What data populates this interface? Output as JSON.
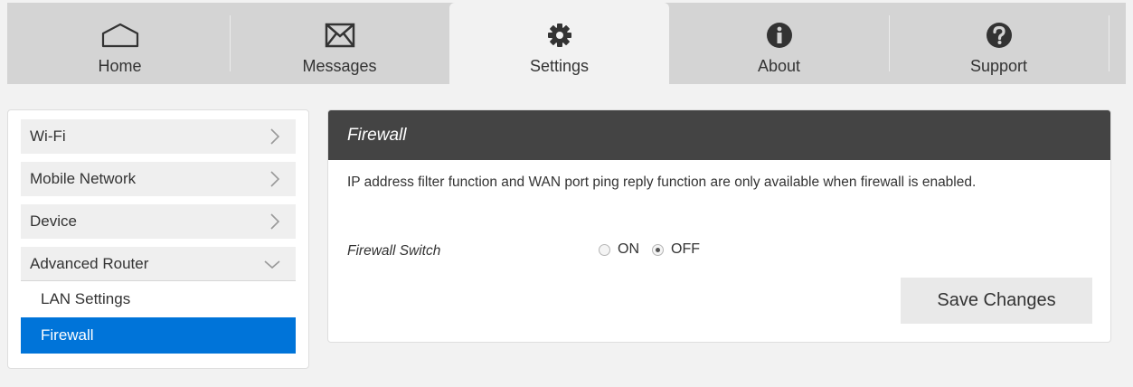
{
  "nav": {
    "tabs": [
      {
        "label": "Home",
        "icon": "home-icon"
      },
      {
        "label": "Messages",
        "icon": "envelope-icon"
      },
      {
        "label": "Settings",
        "icon": "gear-icon"
      },
      {
        "label": "About",
        "icon": "info-icon"
      },
      {
        "label": "Support",
        "icon": "question-icon"
      }
    ],
    "active": "Settings"
  },
  "sidebar": {
    "items": [
      {
        "label": "Wi-Fi"
      },
      {
        "label": "Mobile Network"
      },
      {
        "label": "Device"
      },
      {
        "label": "Advanced Router"
      }
    ],
    "subitems": [
      {
        "label": "LAN Settings"
      },
      {
        "label": "Firewall"
      }
    ],
    "active_subitem": "Firewall"
  },
  "panel": {
    "title": "Firewall",
    "description": "IP address filter function and WAN port ping reply function are only available when firewall is enabled.",
    "switch_label": "Firewall Switch",
    "on_label": "ON",
    "off_label": "OFF",
    "selected": "OFF",
    "save_label": "Save Changes"
  },
  "colors": {
    "accent": "#0074d9",
    "header": "#444444",
    "nav_bg": "#d4d4d4"
  }
}
